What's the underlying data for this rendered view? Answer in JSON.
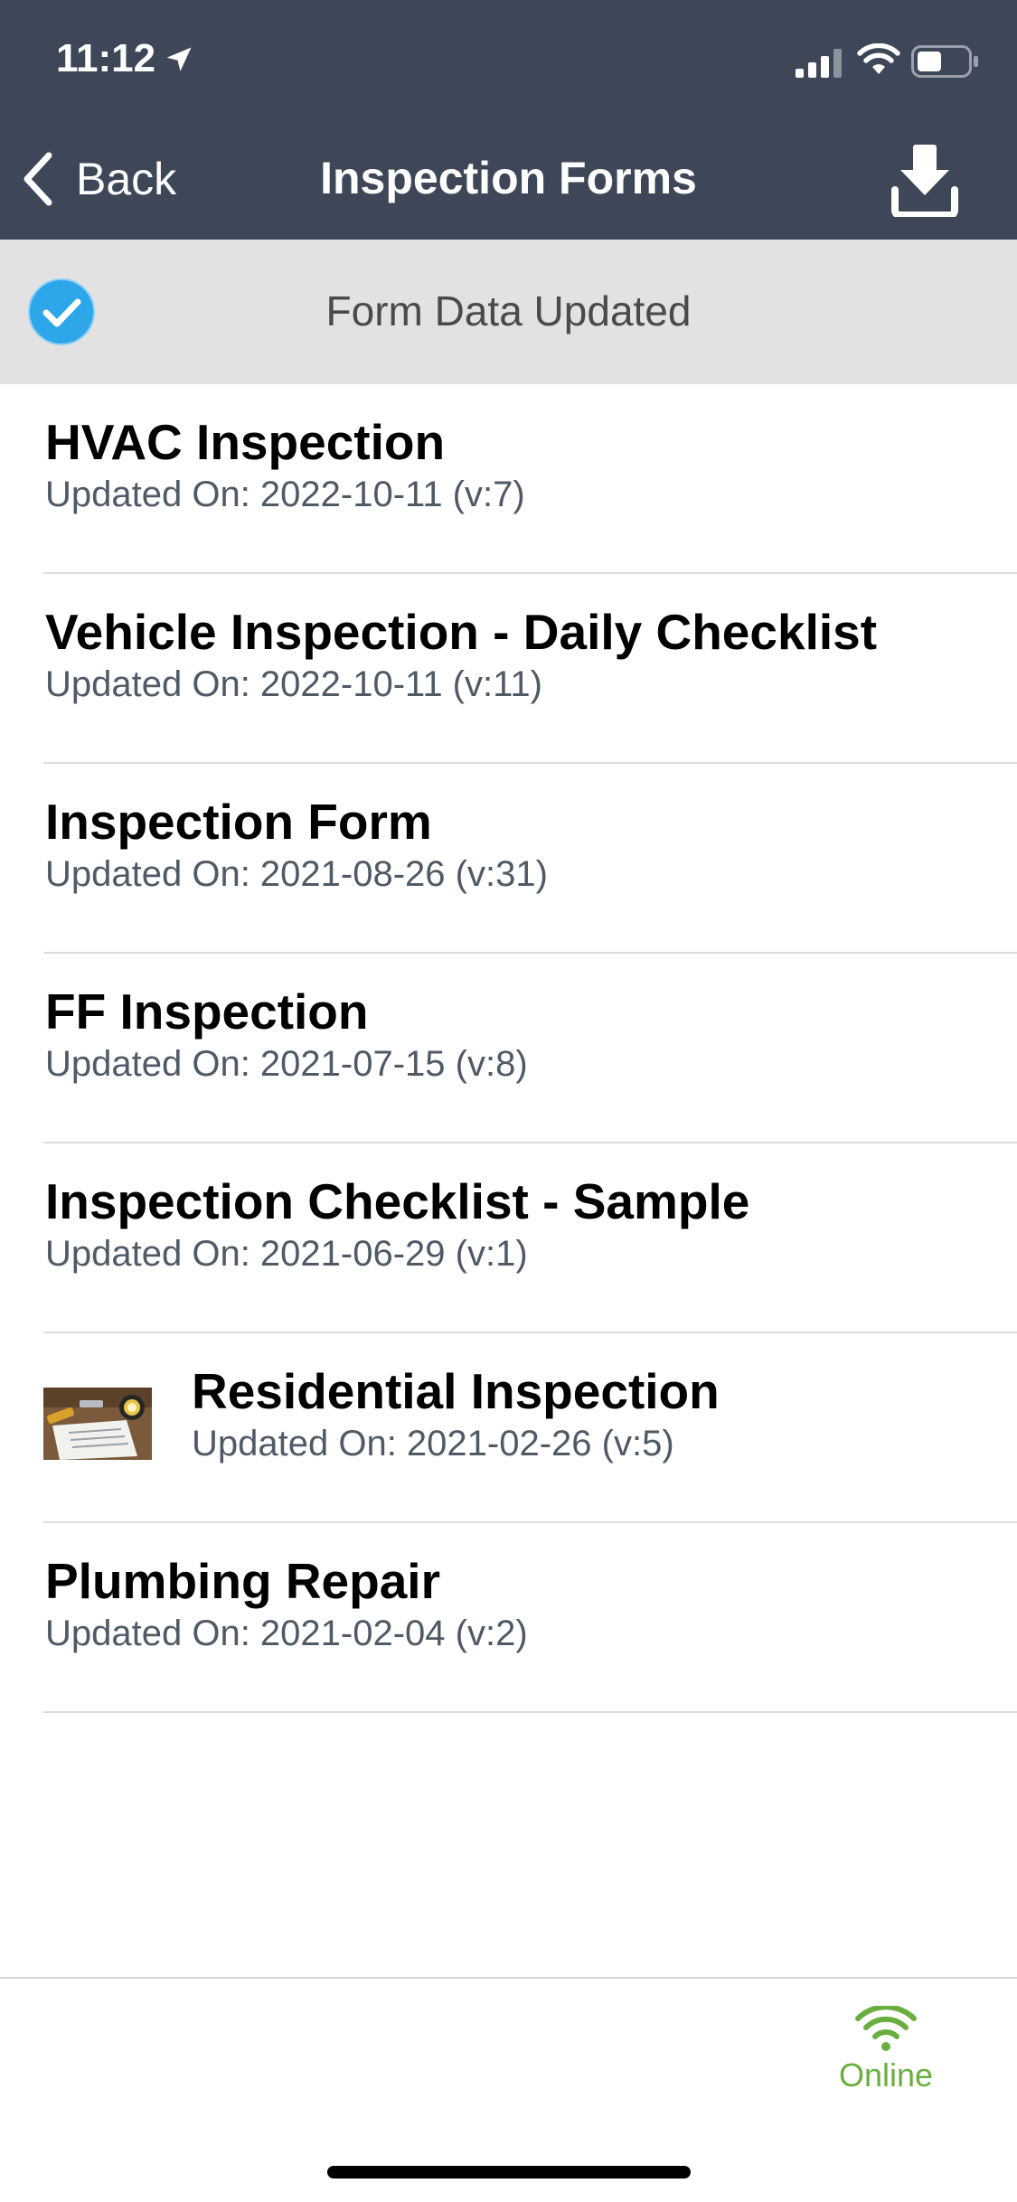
{
  "status_bar": {
    "time": "11:12",
    "location_icon": "location-arrow-icon",
    "signal_icon": "cellular-signal-icon",
    "wifi_icon": "wifi-icon",
    "battery_icon": "battery-icon"
  },
  "nav": {
    "back_label": "Back",
    "back_icon": "chevron-left-icon",
    "title": "Inspection Forms",
    "download_icon": "download-icon"
  },
  "notice": {
    "icon": "check-circle-icon",
    "text": "Form Data Updated"
  },
  "forms": [
    {
      "title": "HVAC Inspection",
      "subtitle": "Updated On: 2022-10-11 (v:7)"
    },
    {
      "title": "Vehicle Inspection - Daily Checklist",
      "subtitle": "Updated On: 2022-10-11 (v:11)"
    },
    {
      "title": "Inspection Form",
      "subtitle": "Updated On: 2021-08-26 (v:31)"
    },
    {
      "title": "FF Inspection",
      "subtitle": "Updated On: 2021-07-15 (v:8)"
    },
    {
      "title": "Inspection Checklist - Sample",
      "subtitle": "Updated On: 2021-06-29 (v:1)"
    },
    {
      "title": "Residential Inspection",
      "subtitle": "Updated On: 2021-02-26 (v:5)",
      "thumbnail": "inspection-tools-thumbnail"
    },
    {
      "title": "Plumbing Repair",
      "subtitle": "Updated On: 2021-02-04 (v:2)"
    }
  ],
  "connection": {
    "icon": "wifi-icon",
    "label": "Online"
  },
  "colors": {
    "header_bg": "#3d4757",
    "notice_bg": "#e2e2e2",
    "check_blue": "#2ea6ea",
    "online_green": "#6aae3f"
  }
}
